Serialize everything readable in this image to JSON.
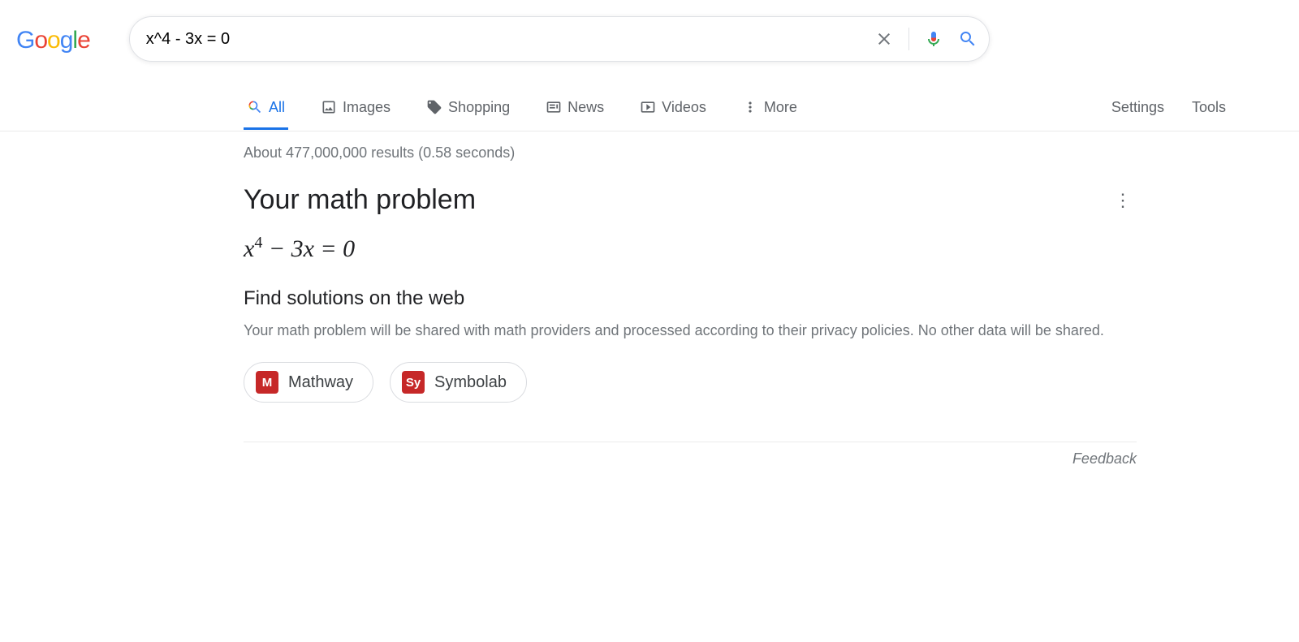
{
  "logo_text": "Google",
  "search": {
    "value": "x^4 - 3x = 0"
  },
  "tabs": {
    "all": "All",
    "images": "Images",
    "shopping": "Shopping",
    "news": "News",
    "videos": "Videos",
    "more": "More"
  },
  "right_links": {
    "settings": "Settings",
    "tools": "Tools"
  },
  "result_stats": "About 477,000,000 results (0.58 seconds)",
  "card": {
    "title": "Your math problem",
    "equation_base": "x",
    "equation_exp": "4",
    "equation_rest": " − 3x = 0",
    "subheading": "Find solutions on the web",
    "disclaimer": "Your math problem will be shared with math providers and processed according to their privacy policies. No other data will be shared.",
    "providers": {
      "mathway": {
        "icon_text": "M",
        "label": "Mathway"
      },
      "symbolab": {
        "icon_text": "Sy",
        "label": "Symbolab"
      }
    }
  },
  "feedback": "Feedback"
}
